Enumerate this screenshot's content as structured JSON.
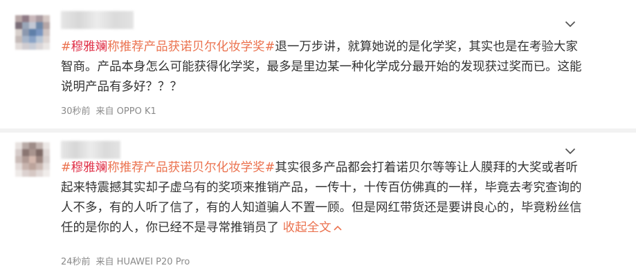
{
  "comments": [
    {
      "hashtag_name": "穆雅斓",
      "hashtag_rest": "称推荐产品获诺贝尔化妆学奖#",
      "body": "退一万步讲，就算她说的是化学奖，其实也是在考验大家智商。产品本身怎么可能获得化学奖，最多是里边某一种化学成分最开始的发现获过奖而已。这能说明产品有多好？？？",
      "time": "30秒前",
      "source": "来自 OPPO K1",
      "avatar_colors": [
        "#b9a8a8",
        "#8f7a85",
        "#c9b8bb",
        "#a99aa0",
        "#d4c7c4",
        "#7a6e78",
        "#9aa6b8",
        "#c3c8d4",
        "#6f88a8",
        "#b5a6a6",
        "#d8d0cc",
        "#8c98ae",
        "#5f7fa8",
        "#7995c0",
        "#cfc4c2",
        "#c4bab8",
        "#a7b5c9",
        "#8aa3c6",
        "#b9c6d6",
        "#dcd4d2",
        "#e2dcda",
        "#d0ccd0",
        "#c8ccd6",
        "#dad6d8",
        "#eae6e4"
      ]
    },
    {
      "hashtag_name": "穆雅斓",
      "hashtag_rest": "称推荐产品获诺贝尔化妆学奖#",
      "body": "其实很多产品都会打着诺贝尔等等让人膜拜的大奖或者听起来特震撼其实却子虚乌有的奖项来推销产品，一传十，十传百仿佛真的一样，毕竟去考究查询的人不多，有的人听了信了，有的人知道骗人不置一顾。但是网红带货还是要讲良心的，毕竟粉丝信任的是你的人，你已经不是寻常推销员了",
      "expand_label": "收起全文",
      "time": "24秒前",
      "source": "来自 HUAWEI P20 Pro",
      "avatar_colors": [
        "#e8e2e0",
        "#b8aaa6",
        "#9e8c88",
        "#c4b6b2",
        "#ece8e6",
        "#d6ccca",
        "#8a7672",
        "#a8948e",
        "#7e6a66",
        "#e0d8d6",
        "#cabcb8",
        "#b09a94",
        "#d4b8ae",
        "#9c8680",
        "#d8d0ce",
        "#e4dcda",
        "#c8b4ae",
        "#bca49c",
        "#cbb9b3",
        "#e6e0de",
        "#eeeae8",
        "#dcd2d0",
        "#d6c8c4",
        "#e2dad8",
        "#f0ecea"
      ]
    }
  ]
}
